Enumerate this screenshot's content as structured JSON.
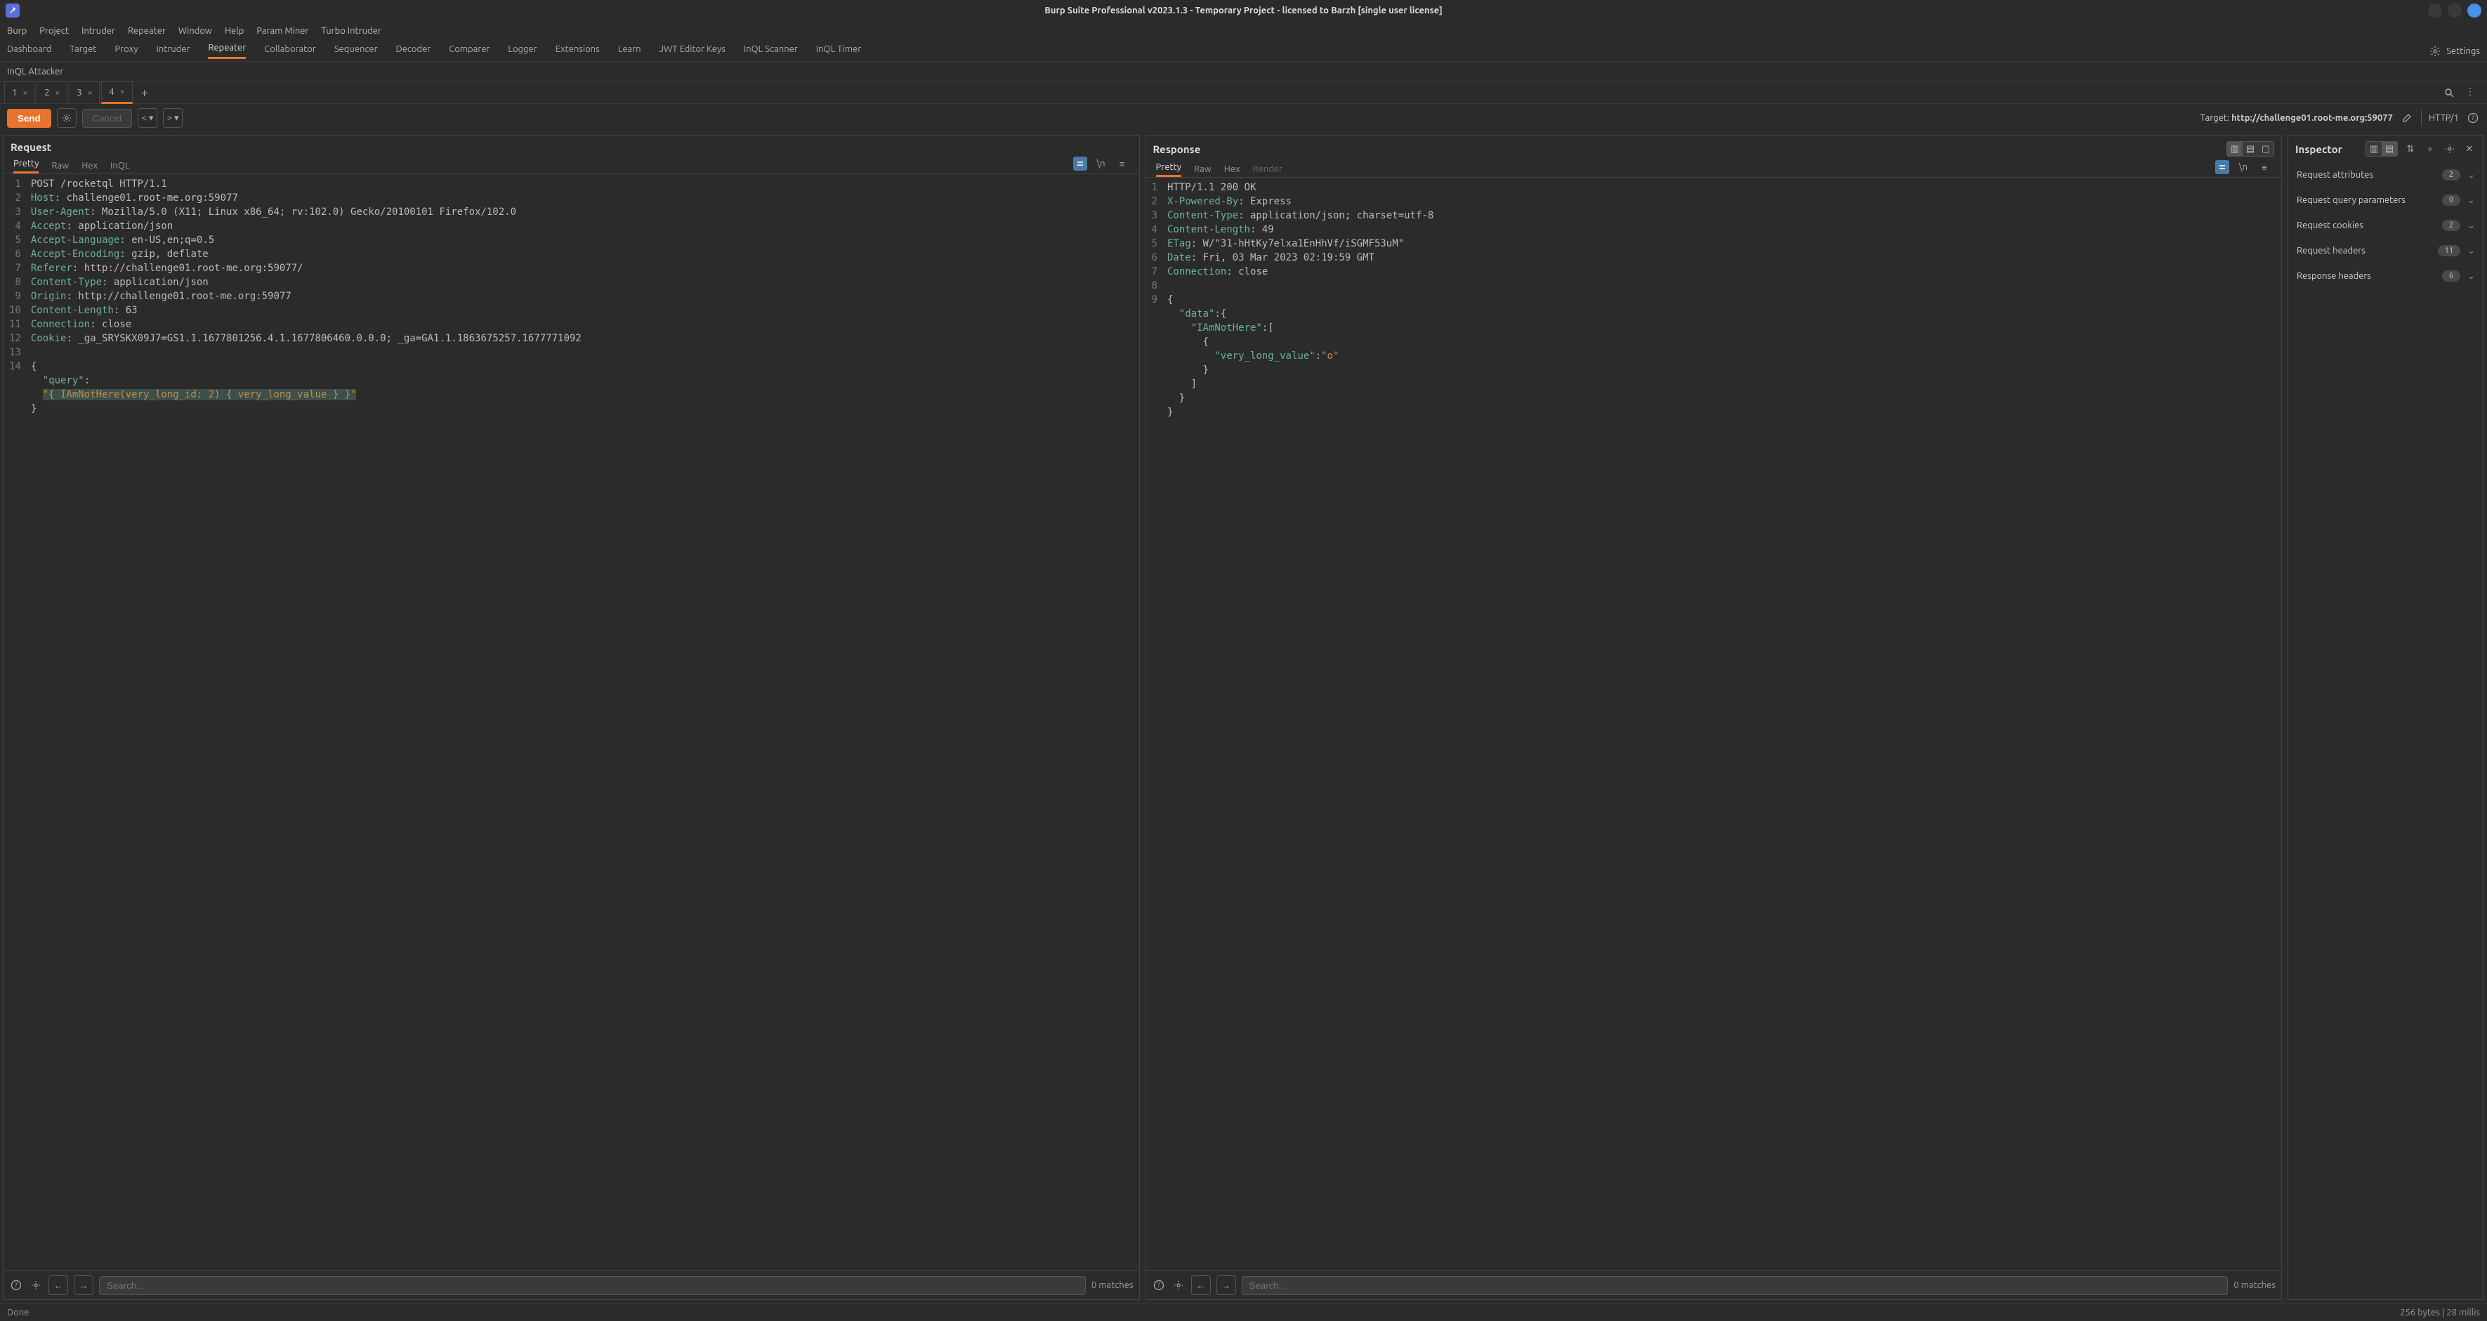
{
  "titlebar": {
    "title": "Burp Suite Professional v2023.1.3 - Temporary Project - licensed to Barzh [single user license]"
  },
  "menubar": [
    "Burp",
    "Project",
    "Intruder",
    "Repeater",
    "Window",
    "Help",
    "Param Miner",
    "Turbo Intruder"
  ],
  "tooltabs": [
    "Dashboard",
    "Target",
    "Proxy",
    "Intruder",
    "Repeater",
    "Collaborator",
    "Sequencer",
    "Decoder",
    "Comparer",
    "Logger",
    "Extensions",
    "Learn",
    "JWT Editor Keys",
    "InQL Scanner",
    "InQL Timer"
  ],
  "tooltabs_active": "Repeater",
  "tooltabs2": [
    "InQL Attacker"
  ],
  "settings_label": "Settings",
  "repeater_tabs": [
    "1",
    "2",
    "3",
    "4"
  ],
  "repeater_active": "4",
  "action": {
    "send": "Send",
    "cancel": "Cancel",
    "target_prefix": "Target: ",
    "target_value": "http://challenge01.root-me.org:59077",
    "http_label": "HTTP/1"
  },
  "request": {
    "title": "Request",
    "tabs": [
      "Pretty",
      "Raw",
      "Hex",
      "InQL"
    ],
    "active_tab": "Pretty",
    "lines": [
      {
        "n": 1,
        "html": "<span class='hv'>POST /rocketql HTTP/1.1</span>"
      },
      {
        "n": 2,
        "html": "<span class='hk'>Host</span>: <span class='hv'>challenge01.root-me.org:59077</span>"
      },
      {
        "n": 3,
        "html": "<span class='hk'>User-Agent</span>: <span class='hv'>Mozilla/5.0 (X11; Linux x86_64; rv:102.0) Gecko/20100101 Firefox/102.0</span>"
      },
      {
        "n": 4,
        "html": "<span class='hk'>Accept</span>: <span class='hv'>application/json</span>"
      },
      {
        "n": 5,
        "html": "<span class='hk'>Accept-Language</span>: <span class='hv'>en-US,en;q=0.5</span>"
      },
      {
        "n": 6,
        "html": "<span class='hk'>Accept-Encoding</span>: <span class='hv'>gzip, deflate</span>"
      },
      {
        "n": 7,
        "html": "<span class='hk'>Referer</span>: <span class='hv'>http://challenge01.root-me.org:59077/</span>"
      },
      {
        "n": 8,
        "html": "<span class='hk'>Content-Type</span>: <span class='hv'>application/json</span>"
      },
      {
        "n": 9,
        "html": "<span class='hk'>Origin</span>: <span class='hv'>http://challenge01.root-me.org:59077</span>"
      },
      {
        "n": 10,
        "html": "<span class='hk'>Content-Length</span>: <span class='hv'>63</span>"
      },
      {
        "n": 11,
        "html": "<span class='hk'>Connection</span>: <span class='hv'>close</span>"
      },
      {
        "n": 12,
        "html": "<span class='hk'>Cookie</span>: <span class='hv'>_ga_SRYSKX09J7=GS1.1.1677801256.4.1.1677806460.0.0.0; _ga=GA1.1.1863675257.1677771092</span>"
      },
      {
        "n": 13,
        "html": ""
      },
      {
        "n": 14,
        "html": "{<br>&nbsp;&nbsp;<span class='js-key'>\"query\"</span>:<br>&nbsp;&nbsp;<span class='js-str hl'>\"{ IAmNotHere(very_long_id: 2) { very_long_value } }\"</span><br>}"
      }
    ],
    "search_placeholder": "Search...",
    "matches": "0 matches"
  },
  "response": {
    "title": "Response",
    "tabs": [
      "Pretty",
      "Raw",
      "Hex",
      "Render"
    ],
    "active_tab": "Pretty",
    "disabled_tab": "Render",
    "lines": [
      {
        "n": 1,
        "html": "<span class='hv'>HTTP/1.1 200 OK</span>"
      },
      {
        "n": 2,
        "html": "<span class='hk'>X-Powered-By</span>: <span class='hv'>Express</span>"
      },
      {
        "n": 3,
        "html": "<span class='hk'>Content-Type</span>: <span class='hv'>application/json; charset=utf-8</span>"
      },
      {
        "n": 4,
        "html": "<span class='hk'>Content-Length</span>: <span class='hv'>49</span>"
      },
      {
        "n": 5,
        "html": "<span class='hk'>ETag</span>: <span class='hv'>W/\"31-hHtKy7elxa1EnHhVf/iSGMF53uM\"</span>"
      },
      {
        "n": 6,
        "html": "<span class='hk'>Date</span>: <span class='hv'>Fri, 03 Mar 2023 02:19:59 GMT</span>"
      },
      {
        "n": 7,
        "html": "<span class='hk'>Connection</span>: <span class='hv'>close</span>"
      },
      {
        "n": 8,
        "html": ""
      },
      {
        "n": 9,
        "html": "{<br>&nbsp;&nbsp;<span class='js-key'>\"data\"</span>:{<br>&nbsp;&nbsp;&nbsp;&nbsp;<span class='js-key'>\"IAmNotHere\"</span>:[<br>&nbsp;&nbsp;&nbsp;&nbsp;&nbsp;&nbsp;{<br>&nbsp;&nbsp;&nbsp;&nbsp;&nbsp;&nbsp;&nbsp;&nbsp;<span class='js-key'>\"very_long_value\"</span>:<span class='js-str'>\"o\"</span><br>&nbsp;&nbsp;&nbsp;&nbsp;&nbsp;&nbsp;}<br>&nbsp;&nbsp;&nbsp;&nbsp;]<br>&nbsp;&nbsp;}<br>}"
      }
    ],
    "search_placeholder": "Search...",
    "matches": "0 matches"
  },
  "inspector": {
    "title": "Inspector",
    "rows": [
      {
        "label": "Request attributes",
        "count": "2"
      },
      {
        "label": "Request query parameters",
        "count": "0"
      },
      {
        "label": "Request cookies",
        "count": "2"
      },
      {
        "label": "Request headers",
        "count": "11"
      },
      {
        "label": "Response headers",
        "count": "6"
      }
    ]
  },
  "statusbar": {
    "left": "Done",
    "right": "256 bytes | 28 millis"
  }
}
